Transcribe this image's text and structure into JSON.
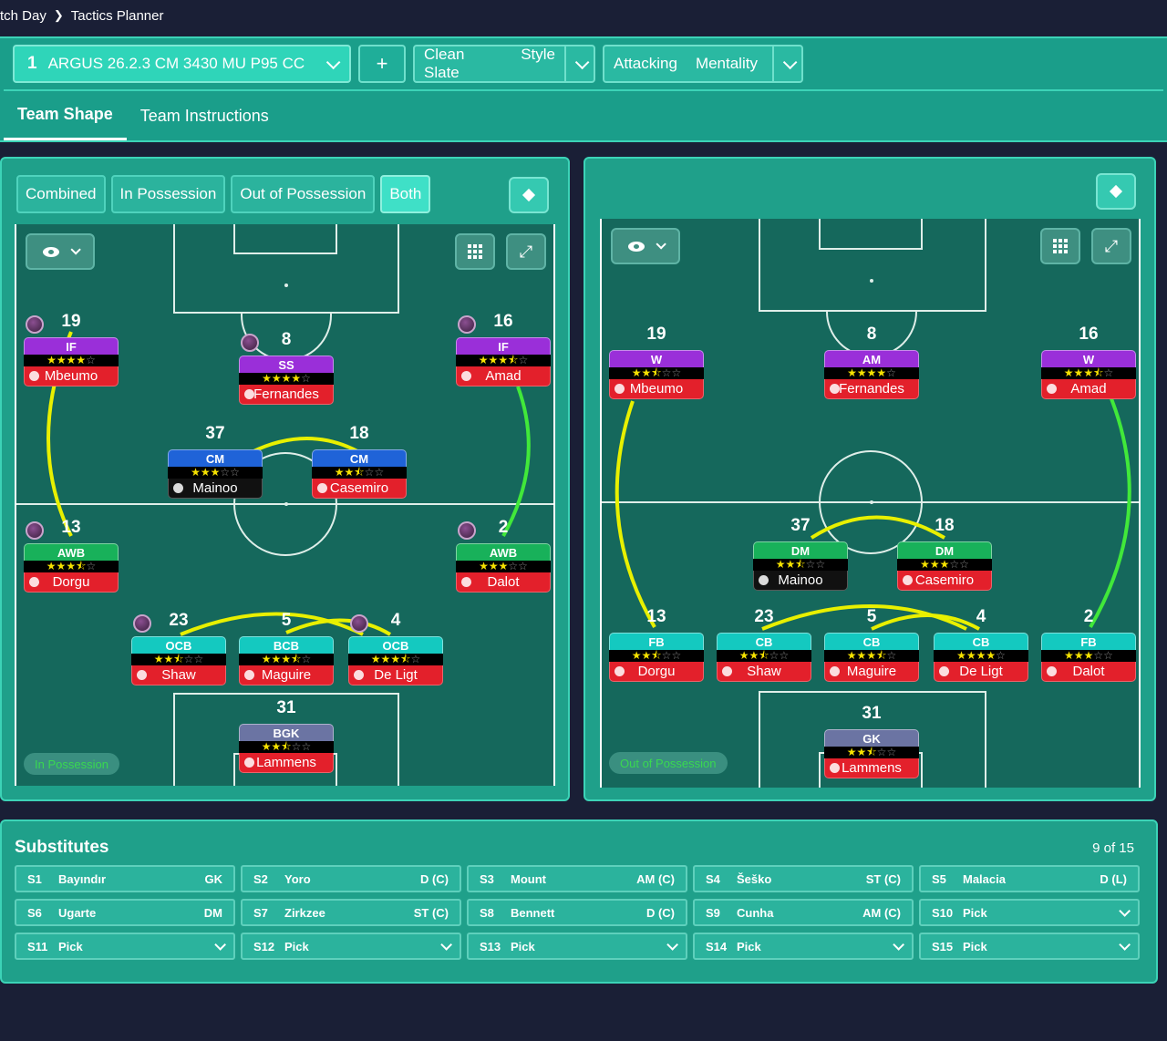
{
  "breadcrumb": {
    "parent": "tch Day",
    "current": "Tactics Planner"
  },
  "tactic": {
    "slot": "1",
    "name": "ARGUS 26.2.3 CM 3430 MU P95 CC",
    "add_label": "+"
  },
  "style": {
    "value": "Clean Slate",
    "label": "Style"
  },
  "mentality": {
    "value": "Attacking",
    "label": "Mentality"
  },
  "tabs": [
    "Team Shape",
    "Team Instructions"
  ],
  "modes": [
    "Combined",
    "In Possession",
    "Out of Possession",
    "Both"
  ],
  "active_mode": "Both",
  "left_pitch": {
    "phase_label": "In Possession",
    "players": [
      {
        "num": "19",
        "role": "IF",
        "stars": 4,
        "name": "Mbeumo",
        "badge": true
      },
      {
        "num": "8",
        "role": "SS",
        "stars": 4,
        "name": "Fernandes",
        "badge": true
      },
      {
        "num": "16",
        "role": "IF",
        "stars": 3.5,
        "name": "Amad",
        "badge": true
      },
      {
        "num": "37",
        "role": "CM",
        "stars": 3,
        "name": "Mainoo",
        "shirt": true
      },
      {
        "num": "18",
        "role": "CM",
        "stars": 2.5,
        "name": "Casemiro"
      },
      {
        "num": "13",
        "role": "AWB",
        "stars": 3.5,
        "name": "Dorgu",
        "badge": true
      },
      {
        "num": "2",
        "role": "AWB",
        "stars": 3,
        "name": "Dalot",
        "badge": true
      },
      {
        "num": "23",
        "role": "OCB",
        "stars": 2.5,
        "name": "Shaw",
        "badge": true
      },
      {
        "num": "5",
        "role": "BCB",
        "stars": 3.5,
        "name": "Maguire"
      },
      {
        "num": "4",
        "role": "OCB",
        "stars": 3.5,
        "name": "De Ligt",
        "badge": true
      },
      {
        "num": "31",
        "role": "BGK",
        "stars": 2.5,
        "name": "Lammens"
      }
    ]
  },
  "right_pitch": {
    "phase_label": "Out of Possession",
    "players": [
      {
        "num": "19",
        "role": "W",
        "stars": 2.5,
        "name": "Mbeumo"
      },
      {
        "num": "8",
        "role": "AM",
        "stars": 4,
        "name": "Fernandes"
      },
      {
        "num": "16",
        "role": "W",
        "stars": 3.5,
        "name": "Amad"
      },
      {
        "num": "37",
        "role": "DM",
        "stars": 2.5,
        "name": "Mainoo",
        "shirt": true
      },
      {
        "num": "18",
        "role": "DM",
        "stars": 3,
        "name": "Casemiro"
      },
      {
        "num": "13",
        "role": "FB",
        "stars": 2.5,
        "name": "Dorgu"
      },
      {
        "num": "23",
        "role": "CB",
        "stars": 2.5,
        "name": "Shaw"
      },
      {
        "num": "5",
        "role": "CB",
        "stars": 3.5,
        "name": "Maguire"
      },
      {
        "num": "4",
        "role": "CB",
        "stars": 4,
        "name": "De Ligt"
      },
      {
        "num": "2",
        "role": "FB",
        "stars": 3,
        "name": "Dalot"
      },
      {
        "num": "31",
        "role": "GK",
        "stars": 2.5,
        "name": "Lammens"
      }
    ]
  },
  "substitutes": {
    "title": "Substitutes",
    "count": "9 of 15",
    "slots": [
      {
        "slot": "S1",
        "name": "Bayındır",
        "pos": "GK"
      },
      {
        "slot": "S2",
        "name": "Yoro",
        "pos": "D (C)"
      },
      {
        "slot": "S3",
        "name": "Mount",
        "pos": "AM (C)"
      },
      {
        "slot": "S4",
        "name": "Šeško",
        "pos": "ST (C)"
      },
      {
        "slot": "S5",
        "name": "Malacia",
        "pos": "D (L)"
      },
      {
        "slot": "S6",
        "name": "Ugarte",
        "pos": "DM"
      },
      {
        "slot": "S7",
        "name": "Zirkzee",
        "pos": "ST (C)"
      },
      {
        "slot": "S8",
        "name": "Bennett",
        "pos": "D (C)"
      },
      {
        "slot": "S9",
        "name": "Cunha",
        "pos": "AM (C)"
      },
      {
        "slot": "S10",
        "name": "Pick",
        "pos": ""
      },
      {
        "slot": "S11",
        "name": "Pick",
        "pos": ""
      },
      {
        "slot": "S12",
        "name": "Pick",
        "pos": ""
      },
      {
        "slot": "S13",
        "name": "Pick",
        "pos": ""
      },
      {
        "slot": "S14",
        "name": "Pick",
        "pos": ""
      },
      {
        "slot": "S15",
        "name": "Pick",
        "pos": ""
      }
    ]
  }
}
